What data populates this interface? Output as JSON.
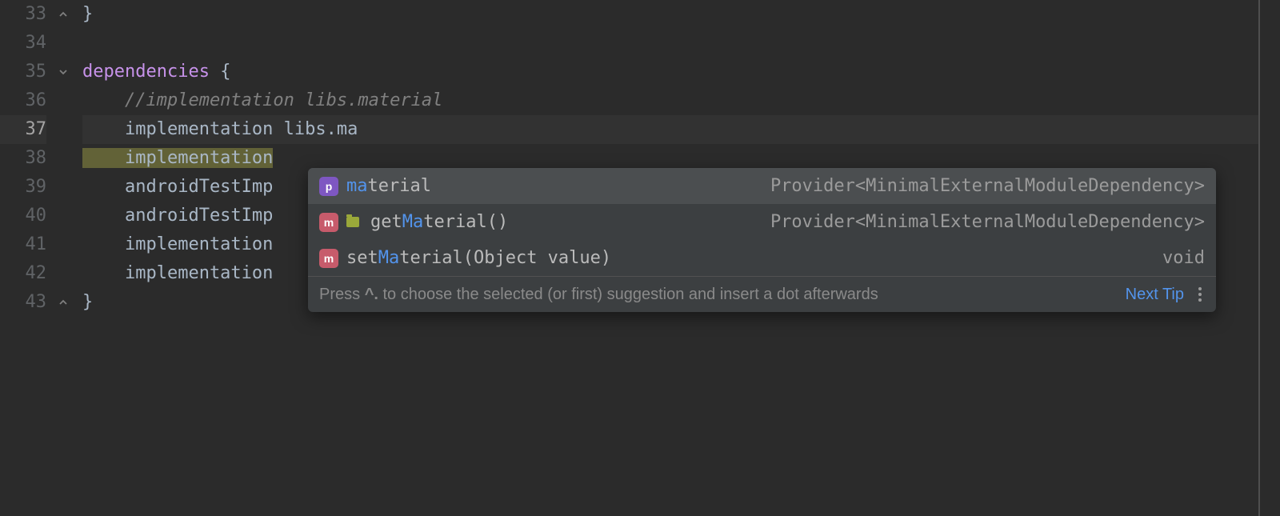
{
  "lines": [
    {
      "num": "33",
      "code": "}"
    },
    {
      "num": "34",
      "code": ""
    },
    {
      "num": "35",
      "kw": "dependencies",
      "rest": " {"
    },
    {
      "num": "36",
      "comment": "    //implementation libs.material"
    },
    {
      "num": "37",
      "dir": "    implementation",
      "sp": " ",
      "arg": "libs.ma",
      "current": true
    },
    {
      "num": "38",
      "dir": "    implementation",
      "hl": true
    },
    {
      "num": "39",
      "dir": "    androidTestImp"
    },
    {
      "num": "40",
      "dir": "    androidTestImp"
    },
    {
      "num": "41",
      "dir": "    implementation"
    },
    {
      "num": "42",
      "dir": "    implementation"
    },
    {
      "num": "43",
      "code": "}"
    }
  ],
  "popup": {
    "items": [
      {
        "icon": "p",
        "pre": "",
        "match": "ma",
        "post": "terial",
        "type": "Provider<MinimalExternalModuleDependency>",
        "folder": false,
        "selected": true
      },
      {
        "icon": "m",
        "pre": "get",
        "match": "Ma",
        "post": "terial()",
        "type": "Provider<MinimalExternalModuleDependency>",
        "folder": true,
        "selected": false
      },
      {
        "icon": "m",
        "pre": "set",
        "match": "Ma",
        "post": "terial(Object value)",
        "type": "void",
        "folder": false,
        "selected": false
      }
    ],
    "hint_prefix": "Press ",
    "hint_key": "^.",
    "hint_suffix": " to choose the selected (or first) suggestion and insert a dot afterwards",
    "next_tip": "Next Tip"
  },
  "icons": {
    "p_label": "p",
    "m_label": "m"
  }
}
